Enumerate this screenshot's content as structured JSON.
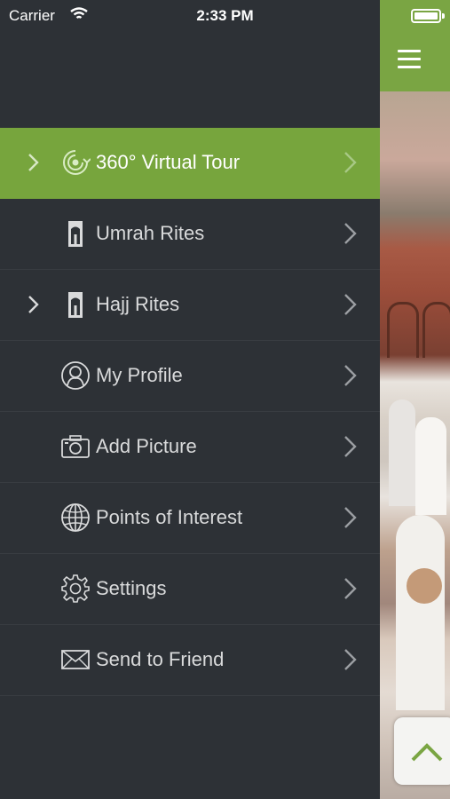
{
  "status_bar": {
    "carrier": "Carrier",
    "time": "2:33 PM"
  },
  "colors": {
    "accent": "#77a53d",
    "sidebar_bg": "#2d3136",
    "text": "#d9dadb"
  },
  "menu": {
    "items": [
      {
        "label": "360° Virtual Tour",
        "icon": "virtual-tour-icon",
        "active": true,
        "expandable": true
      },
      {
        "label": "Umrah Rites",
        "icon": "kaaba-icon",
        "active": false,
        "expandable": false
      },
      {
        "label": "Hajj Rites",
        "icon": "kaaba-icon",
        "active": false,
        "expandable": true
      },
      {
        "label": "My Profile",
        "icon": "profile-icon",
        "active": false,
        "expandable": false
      },
      {
        "label": "Add Picture",
        "icon": "camera-icon",
        "active": false,
        "expandable": false
      },
      {
        "label": "Points of Interest",
        "icon": "globe-icon",
        "active": false,
        "expandable": false
      },
      {
        "label": "Settings",
        "icon": "gear-icon",
        "active": false,
        "expandable": false
      },
      {
        "label": "Send to Friend",
        "icon": "envelope-icon",
        "active": false,
        "expandable": false
      }
    ]
  }
}
